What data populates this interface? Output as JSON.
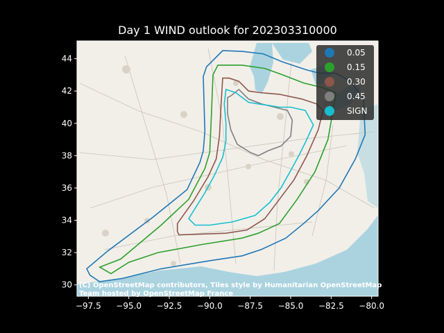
{
  "title": "Day 1 WIND outlook for 202303310000",
  "map": {
    "lon_range": [
      -98.2,
      -79.6
    ],
    "lat_range": [
      29.3,
      45.1
    ],
    "attribution_line1": "(C) OpenStreetMap contributors, Tiles style by Humanitarian OpenStreetMap",
    "attribution_line2": "Team hosted by OpenStreetMap France"
  },
  "axes": {
    "x_ticks": [
      {
        "value": -97.5,
        "label": "−97.5"
      },
      {
        "value": -95.0,
        "label": "−95.0"
      },
      {
        "value": -92.5,
        "label": "−92.5"
      },
      {
        "value": -90.0,
        "label": "−90.0"
      },
      {
        "value": -87.5,
        "label": "−87.5"
      },
      {
        "value": -85.0,
        "label": "−85.0"
      },
      {
        "value": -82.5,
        "label": "−82.5"
      },
      {
        "value": -80.0,
        "label": "−80.0"
      }
    ],
    "y_ticks": [
      {
        "value": 30,
        "label": "30"
      },
      {
        "value": 32,
        "label": "32"
      },
      {
        "value": 34,
        "label": "34"
      },
      {
        "value": 36,
        "label": "36"
      },
      {
        "value": 38,
        "label": "38"
      },
      {
        "value": 40,
        "label": "40"
      },
      {
        "value": 42,
        "label": "42"
      },
      {
        "value": 44,
        "label": "44"
      }
    ]
  },
  "legend": {
    "position": "top-right",
    "entries": [
      {
        "label": "0.05",
        "color": "#1f77b4"
      },
      {
        "label": "0.15",
        "color": "#2ca02c"
      },
      {
        "label": "0.30",
        "color": "#8c564b"
      },
      {
        "label": "0.45",
        "color": "#7f7f7f"
      },
      {
        "label": "SIGN",
        "color": "#17becf"
      }
    ]
  },
  "contours": [
    {
      "label": "0.05",
      "color": "#1f77b4",
      "points": [
        [
          -97.6,
          31.0
        ],
        [
          -97.4,
          30.6
        ],
        [
          -96.8,
          30.2
        ],
        [
          -95.4,
          30.4
        ],
        [
          -93.0,
          31.0
        ],
        [
          -90.0,
          31.5
        ],
        [
          -88.0,
          31.8
        ],
        [
          -86.8,
          32.2
        ],
        [
          -85.3,
          32.9
        ],
        [
          -84.2,
          33.8
        ],
        [
          -83.3,
          34.6
        ],
        [
          -82.0,
          36.0
        ],
        [
          -81.0,
          37.8
        ],
        [
          -80.4,
          39.3
        ],
        [
          -80.5,
          41.5
        ],
        [
          -81.3,
          42.6
        ],
        [
          -82.2,
          43.1
        ],
        [
          -83.2,
          43.1
        ],
        [
          -84.0,
          43.3
        ],
        [
          -85.5,
          43.8
        ],
        [
          -86.7,
          44.3
        ],
        [
          -88.0,
          44.45
        ],
        [
          -89.2,
          44.5
        ],
        [
          -90.2,
          43.5
        ],
        [
          -90.4,
          42.9
        ],
        [
          -90.3,
          39.5
        ],
        [
          -90.4,
          38.3
        ],
        [
          -90.6,
          37.6
        ],
        [
          -91.4,
          35.9
        ],
        [
          -93.5,
          34.2
        ],
        [
          -96.3,
          32.1
        ],
        [
          -97.6,
          31.0
        ]
      ]
    },
    {
      "label": "0.15",
      "color": "#2ca02c",
      "points": [
        [
          -96.8,
          31.1
        ],
        [
          -96.1,
          30.7
        ],
        [
          -95.0,
          31.4
        ],
        [
          -93.2,
          32.0
        ],
        [
          -90.5,
          32.5
        ],
        [
          -88.0,
          32.9
        ],
        [
          -87.0,
          33.2
        ],
        [
          -85.7,
          33.8
        ],
        [
          -84.6,
          35.3
        ],
        [
          -83.5,
          37.0
        ],
        [
          -82.7,
          39.0
        ],
        [
          -82.4,
          40.7
        ],
        [
          -82.2,
          41.9
        ],
        [
          -83.0,
          42.2
        ],
        [
          -84.2,
          42.5
        ],
        [
          -85.5,
          43.0
        ],
        [
          -86.6,
          43.4
        ],
        [
          -88.0,
          43.6
        ],
        [
          -89.5,
          43.6
        ],
        [
          -89.8,
          43.0
        ],
        [
          -89.9,
          40.5
        ],
        [
          -90.0,
          38.2
        ],
        [
          -90.3,
          37.2
        ],
        [
          -91.3,
          35.3
        ],
        [
          -93.0,
          33.7
        ],
        [
          -95.5,
          31.6
        ],
        [
          -96.8,
          31.1
        ]
      ]
    },
    {
      "label": "0.30",
      "color": "#8c564b",
      "points": [
        [
          -92.0,
          33.3
        ],
        [
          -91.9,
          33.1
        ],
        [
          -89.0,
          33.2
        ],
        [
          -87.7,
          33.4
        ],
        [
          -86.6,
          34.1
        ],
        [
          -85.7,
          35.3
        ],
        [
          -84.8,
          36.5
        ],
        [
          -84.0,
          38.0
        ],
        [
          -83.3,
          39.6
        ],
        [
          -83.0,
          40.8
        ],
        [
          -83.4,
          41.2
        ],
        [
          -84.3,
          41.5
        ],
        [
          -85.7,
          41.8
        ],
        [
          -86.9,
          41.9
        ],
        [
          -87.6,
          42.0
        ],
        [
          -88.2,
          42.6
        ],
        [
          -88.8,
          42.8
        ],
        [
          -89.2,
          42.8
        ],
        [
          -89.3,
          41.2
        ],
        [
          -89.4,
          39.2
        ],
        [
          -89.6,
          37.8
        ],
        [
          -90.1,
          36.7
        ],
        [
          -91.0,
          35.2
        ],
        [
          -92.0,
          33.8
        ],
        [
          -92.0,
          33.3
        ]
      ]
    },
    {
      "label": "0.45",
      "color": "#7f7f7f",
      "points": [
        [
          -88.7,
          41.7
        ],
        [
          -88.9,
          41.6
        ],
        [
          -88.9,
          40.6
        ],
        [
          -88.7,
          39.6
        ],
        [
          -88.3,
          38.7
        ],
        [
          -87.5,
          38.2
        ],
        [
          -87.0,
          38.0
        ],
        [
          -86.4,
          38.3
        ],
        [
          -85.6,
          38.6
        ],
        [
          -85.0,
          39.2
        ],
        [
          -84.9,
          40.2
        ],
        [
          -85.2,
          40.8
        ],
        [
          -86.0,
          41.0
        ],
        [
          -86.8,
          41.2
        ],
        [
          -87.6,
          41.5
        ],
        [
          -88.2,
          42.1
        ],
        [
          -88.7,
          41.7
        ]
      ]
    },
    {
      "label": "SIGN",
      "color": "#17becf",
      "points": [
        [
          -91.3,
          34.1
        ],
        [
          -90.9,
          33.7
        ],
        [
          -90.0,
          33.7
        ],
        [
          -88.6,
          33.9
        ],
        [
          -87.2,
          34.3
        ],
        [
          -86.3,
          35.1
        ],
        [
          -85.6,
          36.0
        ],
        [
          -85.1,
          36.9
        ],
        [
          -84.5,
          38.0
        ],
        [
          -84.1,
          38.8
        ],
        [
          -83.6,
          39.9
        ],
        [
          -84.1,
          40.8
        ],
        [
          -85.0,
          41.0
        ],
        [
          -85.7,
          41.0
        ],
        [
          -86.3,
          41.1
        ],
        [
          -87.0,
          41.2
        ],
        [
          -87.6,
          41.3
        ],
        [
          -88.4,
          41.9
        ],
        [
          -89.0,
          42.1
        ],
        [
          -89.1,
          41.2
        ],
        [
          -89.0,
          40.0
        ],
        [
          -89.0,
          38.9
        ],
        [
          -89.2,
          37.9
        ],
        [
          -89.7,
          36.8
        ],
        [
          -90.3,
          35.7
        ],
        [
          -91.3,
          34.1
        ]
      ]
    }
  ]
}
